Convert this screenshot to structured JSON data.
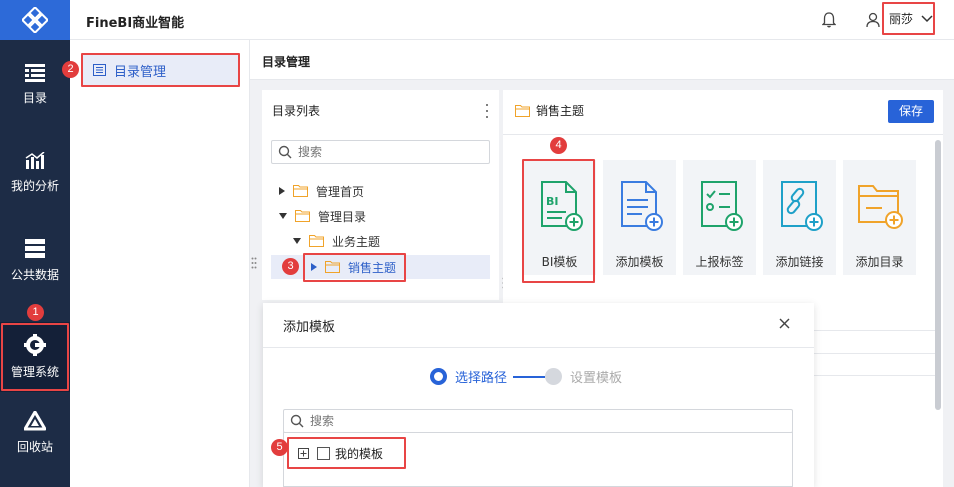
{
  "app": {
    "brand": "FineBI商业智能"
  },
  "rail": {
    "items": [
      {
        "label": "目录",
        "icon": "catalog-icon"
      },
      {
        "label": "我的分析",
        "icon": "analysis-chart-icon"
      },
      {
        "label": "公共数据",
        "icon": "database-icon"
      },
      {
        "label": "管理系统",
        "icon": "gear-icon",
        "active": true
      },
      {
        "label": "回收站",
        "icon": "recycle-icon"
      }
    ]
  },
  "header": {
    "user_name": "丽莎"
  },
  "subnav": {
    "items": [
      {
        "label": "目录管理",
        "icon": "list-icon"
      }
    ]
  },
  "main": {
    "title": "目录管理"
  },
  "directory": {
    "header": "目录列表",
    "search_placeholder": "搜索",
    "tree": [
      {
        "label": "管理首页"
      },
      {
        "label": "管理目录"
      },
      {
        "label": "业务主题"
      },
      {
        "label": "销售主题"
      }
    ]
  },
  "content": {
    "folder_title": "销售主题",
    "save_label": "保存",
    "cards": [
      {
        "label": "BI模板",
        "icon": "bi-template-add-icon",
        "color": "#1fa36b"
      },
      {
        "label": "添加模板",
        "icon": "template-add-icon",
        "color": "#3a7ce0"
      },
      {
        "label": "上报标签",
        "icon": "checklist-add-icon",
        "color": "#1fa36b"
      },
      {
        "label": "添加链接",
        "icon": "link-add-icon",
        "color": "#1ea0c8"
      },
      {
        "label": "添加目录",
        "icon": "folder-add-icon",
        "color": "#f0a32a"
      }
    ]
  },
  "dialog": {
    "title": "添加模板",
    "steps": [
      "选择路径",
      "设置模板"
    ],
    "search_placeholder": "搜索",
    "tree_item": "我的模板"
  },
  "badges": [
    "1",
    "2",
    "3",
    "4",
    "5"
  ],
  "colors": {
    "accent": "#2863d8",
    "rail_bg": "#1d2c46",
    "highlight": "#e84545",
    "selected_row": "#e8ecf8"
  }
}
